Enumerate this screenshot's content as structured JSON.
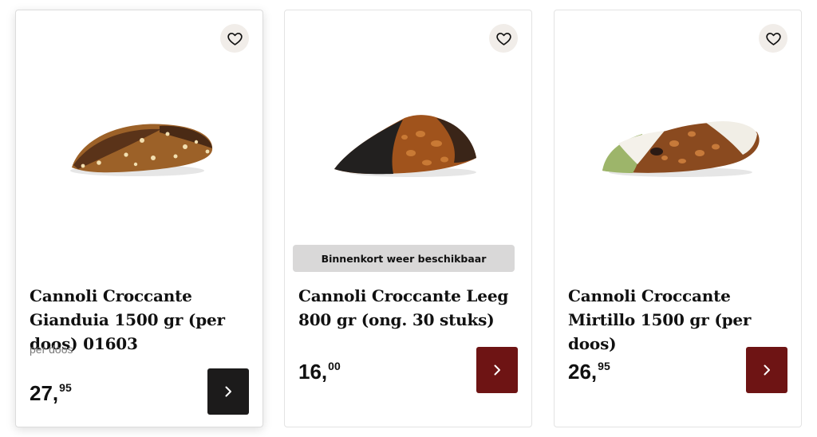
{
  "colors": {
    "button_dark": "#1c1b1b",
    "button_red": "#6e1414",
    "favorite_bg": "#f1ede9",
    "notice_bg": "#d9d8d8"
  },
  "products": [
    {
      "title": "Cannoli Croccante Gianduia 1500 gr (per doos) 01603",
      "unit": "per doos",
      "price_int": "27,",
      "price_dec": "95",
      "notice": "",
      "favorite_icon": "heart-outline-icon",
      "button_icon": "chevron-right-icon"
    },
    {
      "title": "Cannoli Croccante Leeg 800 gr (ong. 30 stuks)",
      "unit": "",
      "price_int": "16,",
      "price_dec": "00",
      "notice": "Binnenkort weer beschikbaar",
      "favorite_icon": "heart-outline-icon",
      "button_icon": "chevron-right-icon"
    },
    {
      "title": "Cannoli Croccante Mirtillo 1500 gr (per doos)",
      "unit": "",
      "price_int": "26,",
      "price_dec": "95",
      "notice": "",
      "favorite_icon": "heart-outline-icon",
      "button_icon": "chevron-right-icon"
    }
  ]
}
